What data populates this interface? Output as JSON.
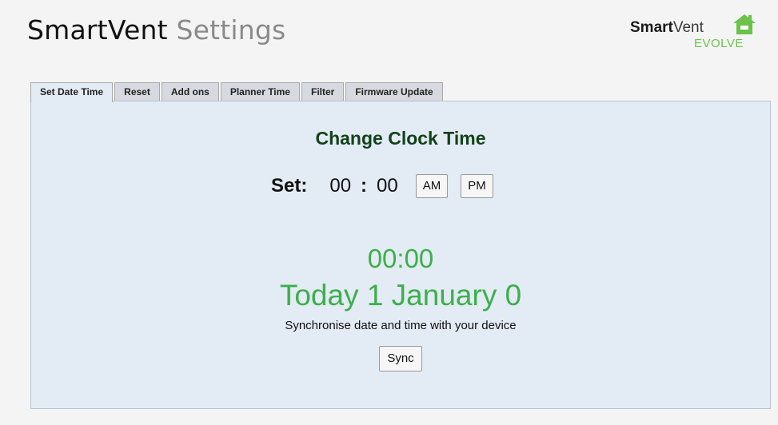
{
  "header": {
    "title_brand": "SmartVent",
    "title_sub": "Settings",
    "logo": {
      "word_bold": "Smart",
      "word_thin": "Vent",
      "tagline": "EVOLVE",
      "icon": "house-icon",
      "color": "#6cc24a"
    }
  },
  "tabs": [
    {
      "label": "Set Date Time",
      "active": true
    },
    {
      "label": "Reset",
      "active": false
    },
    {
      "label": "Add ons",
      "active": false
    },
    {
      "label": "Planner Time",
      "active": false
    },
    {
      "label": "Filter",
      "active": false
    },
    {
      "label": "Firmware Update",
      "active": false
    }
  ],
  "panel": {
    "heading": "Change Clock Time",
    "set_label": "Set:",
    "hours": "00",
    "separator": ":",
    "minutes": "00",
    "am_label": "AM",
    "pm_label": "PM",
    "clock_display": "00:00",
    "date_display": "Today 1 January 0",
    "sync_text": "Synchronise date and time with your device",
    "sync_label": "Sync"
  },
  "colors": {
    "heading": "#13421a",
    "clock": "#3daf4c",
    "panel_bg": "#e3ebf4"
  }
}
